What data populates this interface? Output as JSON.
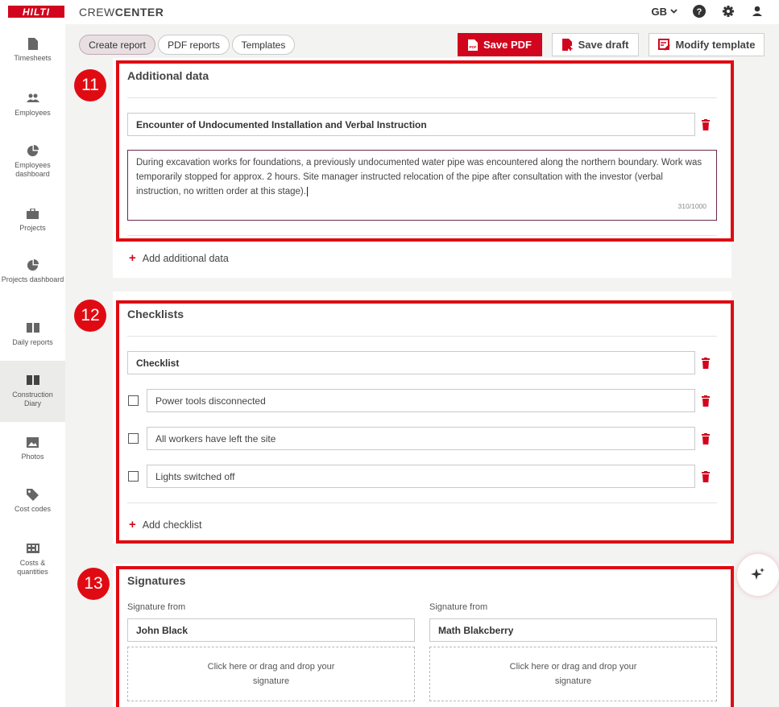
{
  "app": {
    "logo_text": "HILTI",
    "name_light": "CREW",
    "name_bold": "CENTER"
  },
  "header": {
    "language": "GB",
    "icons": [
      "help-icon",
      "gear-icon",
      "user-icon"
    ]
  },
  "sidebar": {
    "items": [
      {
        "label": "Timesheets",
        "icon": "document-icon"
      },
      {
        "label": "Employees",
        "icon": "people-icon"
      },
      {
        "label": "Employees dashboard",
        "icon": "pie-chart-icon"
      },
      {
        "label": "Projects",
        "icon": "briefcase-icon"
      },
      {
        "label": "Projects dashboard",
        "icon": "pie-chart-icon"
      },
      {
        "label": "Daily reports",
        "icon": "book-icon"
      },
      {
        "label": "Construction Diary",
        "icon": "book-icon"
      },
      {
        "label": "Photos",
        "icon": "image-icon"
      },
      {
        "label": "Cost codes",
        "icon": "tag-icon"
      },
      {
        "label": "Costs & quantities",
        "icon": "calculator-icon"
      }
    ],
    "active": "Construction Diary"
  },
  "tabs": [
    {
      "label": "Create report"
    },
    {
      "label": "PDF reports"
    },
    {
      "label": "Templates"
    }
  ],
  "toolbar": {
    "save_pdf": "Save PDF",
    "save_draft": "Save draft",
    "modify_template": "Modify template"
  },
  "colors": {
    "accent": "#d2051e",
    "highlight": "#e00b12",
    "active_tab": "#e8dfe2"
  },
  "additional_data": {
    "badge": "11",
    "title": "Additional data",
    "entry_title": "Encounter of Undocumented Installation and Verbal Instruction",
    "entry_text": "During excavation works for foundations, a previously undocumented water pipe was encountered along the northern boundary. Work was temporarily stopped for approx. 2 hours. Site manager instructed relocation of the pipe after consultation with the investor (verbal instruction, no written order at this stage).",
    "counter": "310/1000",
    "add_label": "Add additional data"
  },
  "checklists": {
    "badge": "12",
    "title": "Checklists",
    "checklist_name": "Checklist",
    "items": [
      {
        "label": "Power tools disconnected",
        "checked": false
      },
      {
        "label": "All workers have left the site",
        "checked": false
      },
      {
        "label": "Lights switched off",
        "checked": false
      }
    ],
    "add_label": "Add checklist"
  },
  "signatures": {
    "badge": "13",
    "title": "Signatures",
    "entries": [
      {
        "label": "Signature from",
        "name": "John Black",
        "drop_line1": "Click here or drag and drop your",
        "drop_line2": "signature"
      },
      {
        "label": "Signature from",
        "name": "Math Blakcberry",
        "drop_line1": "Click here or drag and drop your",
        "drop_line2": "signature"
      }
    ]
  }
}
